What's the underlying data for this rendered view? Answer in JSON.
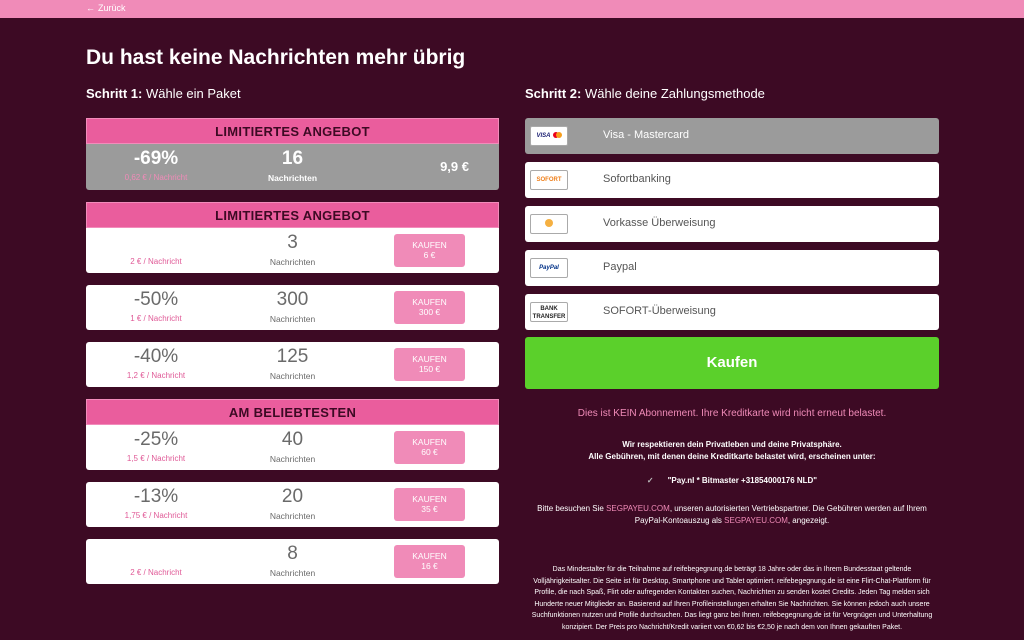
{
  "topbar": {
    "back_label": "Zurück"
  },
  "page_title": "Du hast keine Nachrichten mehr übrig",
  "step1": {
    "bold": "Schritt 1:",
    "text": " Wähle ein Paket"
  },
  "step2": {
    "bold": "Schritt 2:",
    "text": " Wähle deine Zahlungsmethode"
  },
  "banners": [
    "LIMITIERTES ANGEBOT",
    "LIMITIERTES ANGEBOT",
    "AM BELIEBTESTEN"
  ],
  "packages": [
    {
      "discount": "-69%",
      "per": "0,62 € / Nachricht",
      "count": "16",
      "count_label": "Nachrichten",
      "price": "9,9 €"
    },
    {
      "discount": "",
      "per": "2 € / Nachricht",
      "count": "3",
      "count_label": "Nachrichten",
      "buy_label": "KAUFEN",
      "buy_price": "6 €"
    },
    {
      "discount": "-50%",
      "per": "1 € / Nachricht",
      "count": "300",
      "count_label": "Nachrichten",
      "buy_label": "KAUFEN",
      "buy_price": "300 €"
    },
    {
      "discount": "-40%",
      "per": "1,2 € / Nachricht",
      "count": "125",
      "count_label": "Nachrichten",
      "buy_label": "KAUFEN",
      "buy_price": "150 €"
    },
    {
      "discount": "-25%",
      "per": "1,5 € / Nachricht",
      "count": "40",
      "count_label": "Nachrichten",
      "buy_label": "KAUFEN",
      "buy_price": "60 €"
    },
    {
      "discount": "-13%",
      "per": "1,75 € / Nachricht",
      "count": "20",
      "count_label": "Nachrichten",
      "buy_label": "KAUFEN",
      "buy_price": "35 €"
    },
    {
      "discount": "",
      "per": "2 € / Nachricht",
      "count": "8",
      "count_label": "Nachrichten",
      "buy_label": "KAUFEN",
      "buy_price": "16 €"
    }
  ],
  "payments": [
    {
      "label": "Visa - Mastercard",
      "logo": "VISA"
    },
    {
      "label": "Sofortbanking",
      "logo": "SOFORT"
    },
    {
      "label": "Vorkasse Überweisung",
      "logo": ""
    },
    {
      "label": "Paypal",
      "logo": "PayPal"
    },
    {
      "label": "SOFORT-Überweisung",
      "logo": "BANK TRANSFER"
    }
  ],
  "kaufen_label": "Kaufen",
  "no_subscription": "Dies ist KEIN Abonnement. Ihre Kreditkarte wird nicht erneut belastet.",
  "privacy_line1": "Wir respektieren dein Privatleben und deine Privatsphäre.",
  "privacy_line2": "Alle Gebühren, mit denen deine Kreditkarte belastet wird, erscheinen unter:",
  "descriptor": "\"Pay.nl * Bitmaster +31854000176 NLD\"",
  "visit": {
    "t1": "Bitte besuchen Sie ",
    "link1": "SEGPAYEU.COM",
    "t2": ", unseren autorisierten Vertriebspartner. Die Gebühren werden auf Ihrem PayPal-Kontoauszug als ",
    "link2": "SEGPAYEU.COM",
    "t3": ", angezeigt."
  },
  "legal": "Das Mindestalter für die Teilnahme auf reifebegegnung.de beträgt 18 Jahre oder das in Ihrem Bundesstaat geltende Volljährigkeitsalter. Die Seite ist für Desktop, Smartphone und Tablet optimiert. reifebegegnung.de ist eine Flirt-Chat-Plattform für Profile, die nach Spaß, Flirt oder aufregenden Kontakten suchen, Nachrichten zu senden kostet Credits. Jeden Tag melden sich Hunderte neuer Mitglieder an. Basierend auf Ihren Profileinstellungen erhalten Sie Nachrichten. Sie können jedoch auch unsere Suchfunktionen nutzen und Profile durchsuchen. Das liegt ganz bei Ihnen. reifebegegnung.de ist für Vergnügen und Unterhaltung konzipiert. Der Preis pro Nachricht/Kredit variiert von €0,62 bis €2,50 je nach dem von Ihnen gekauften Paket."
}
